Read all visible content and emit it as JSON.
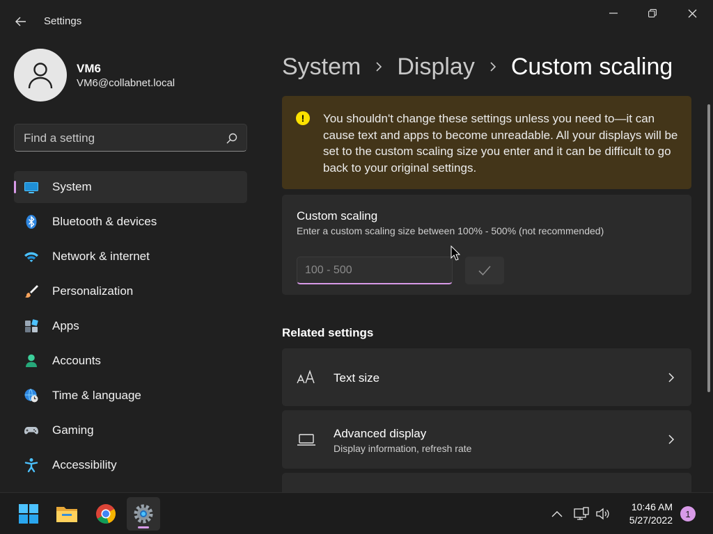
{
  "window": {
    "title": "Settings"
  },
  "user": {
    "name": "VM6",
    "email": "VM6@collabnet.local"
  },
  "search": {
    "placeholder": "Find a setting"
  },
  "sidebar": {
    "items": [
      {
        "label": "System",
        "icon": "system-icon",
        "active": true
      },
      {
        "label": "Bluetooth & devices",
        "icon": "bluetooth-icon"
      },
      {
        "label": "Network & internet",
        "icon": "wifi-icon"
      },
      {
        "label": "Personalization",
        "icon": "brush-icon"
      },
      {
        "label": "Apps",
        "icon": "apps-icon"
      },
      {
        "label": "Accounts",
        "icon": "accounts-icon"
      },
      {
        "label": "Time & language",
        "icon": "globe-clock-icon"
      },
      {
        "label": "Gaming",
        "icon": "gamepad-icon"
      },
      {
        "label": "Accessibility",
        "icon": "accessibility-icon"
      }
    ]
  },
  "breadcrumb": {
    "items": [
      "System",
      "Display"
    ],
    "current": "Custom scaling"
  },
  "warning": {
    "text": "You shouldn't change these settings unless you need to—it can cause text and apps to become unreadable. All your displays will be set to the custom scaling size you enter and it can be difficult to go back to your original settings."
  },
  "custom_scaling": {
    "title": "Custom scaling",
    "description": "Enter a custom scaling size between 100% - 500% (not recommended)",
    "placeholder": "100 - 500"
  },
  "related": {
    "heading": "Related settings",
    "items": [
      {
        "title": "Text size",
        "icon": "text-size-icon"
      },
      {
        "title": "Advanced display",
        "description": "Display information, refresh rate",
        "icon": "laptop-icon"
      }
    ]
  },
  "taskbar": {
    "apps": [
      "start-icon",
      "file-explorer-icon",
      "chrome-icon",
      "settings-icon"
    ],
    "time": "10:46 AM",
    "date": "5/27/2022",
    "notifications": "1"
  },
  "colors": {
    "accent": "#d89ae8",
    "warning_bg": "#433519",
    "warning_icon": "#fce100",
    "window_bg": "#202020",
    "card_bg": "#2b2b2b"
  }
}
